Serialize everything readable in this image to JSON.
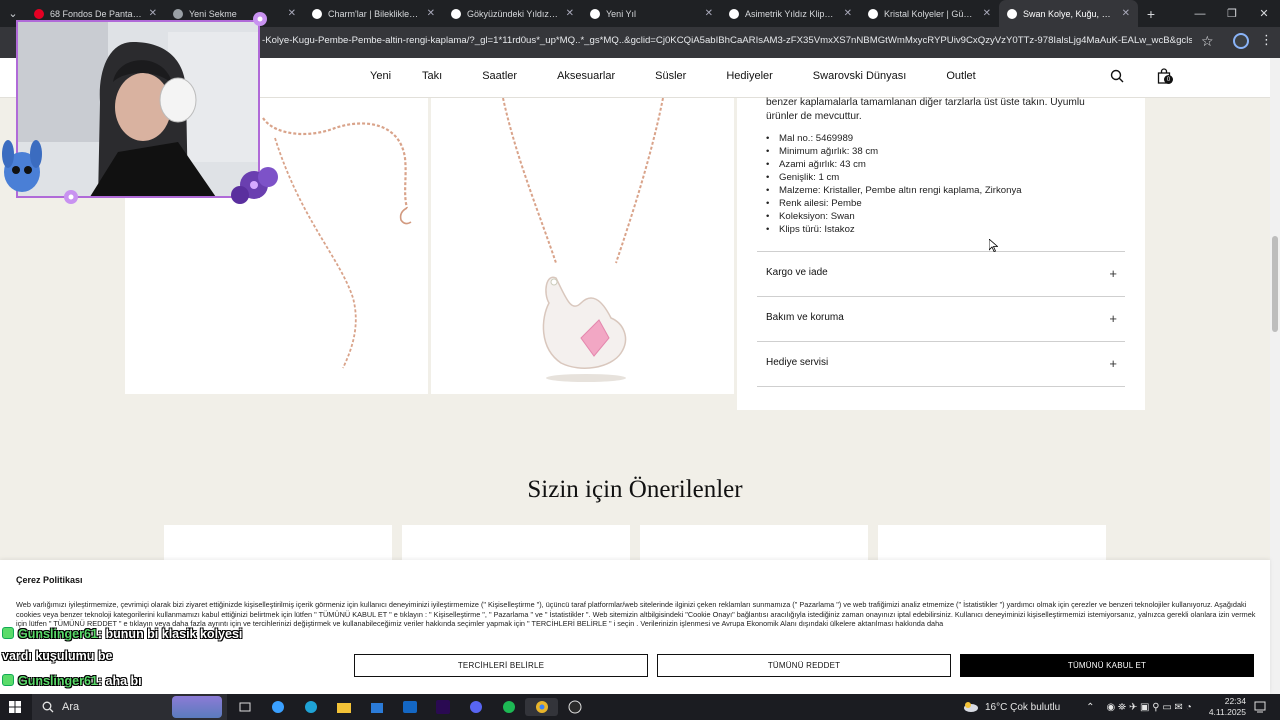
{
  "browser": {
    "tabs": [
      {
        "title": "68 Fondos De Pantalla De",
        "color": "#e60023",
        "active": false
      },
      {
        "title": "Yeni Sekme",
        "color": "#9aa0a6",
        "active": false
      },
      {
        "title": "Charm'lar | Bileklikler ve K",
        "color": "#ffffff",
        "active": false
      },
      {
        "title": "Gökyüzündeki Yıldız Bileziği",
        "color": "#ffffff",
        "active": false
      },
      {
        "title": "Yeni Yıl",
        "color": "#ffffff",
        "active": false
      },
      {
        "title": "Asimetrik Yıldız Klipsli Yıld",
        "color": "#ffffff",
        "active": false
      },
      {
        "title": "Kristal Kolyeler | Gümüş ve",
        "color": "#ffffff",
        "active": false
      },
      {
        "title": "Swan Kolye, Kuğu, Pembe",
        "color": "#ffffff",
        "active": true
      }
    ],
    "url": "-Kolye-Kugu-Pembe-Pembe-altin-rengi-kaplama/?_gl=1*11rd0us*_up*MQ..*_gs*MQ..&gclid=Cj0KCQiA5abIBhCaARIsAM3-zFX35VmxXS7nNBMGtWmMxycRYPUiv9CxQzyVzY0TTz-978IalsLjg4MaAuK-EALw_wcB&gclsrc=aw.ds&..."
  },
  "site": {
    "nav": [
      "Yeni",
      "Takı",
      "Saatler",
      "Aksesuarlar",
      "Süsler",
      "Hediyeler",
      "Swarovski Dünyası",
      "Outlet"
    ],
    "cart_count": "0"
  },
  "product": {
    "description": "benzer kaplamalarla tamamlanan diğer tarzlarla üst üste takın. Uyumlu ürünler de mevcuttur.",
    "specs": [
      "Mal no.: 5469989",
      "Minimum ağırlık: 38 cm",
      "Azami ağırlık: 43 cm",
      "Genişlik: 1 cm",
      "Malzeme:  Kristaller, Pembe altın rengi kaplama, Zirkonya",
      "Renk ailesi:  Pembe",
      "Koleksiyon:  Swan",
      "Klips türü:  Istakoz"
    ],
    "accordions": [
      "Kargo ve iade",
      "Bakım ve koruma",
      "Hediye servisi"
    ]
  },
  "recommendations": {
    "title": "Sizin için Önerilenler"
  },
  "cookie": {
    "title": "Çerez Politikası",
    "text": "Web varlığımızı iyileştirmemize, çevrimiçi olarak bizi ziyaret ettiğinizde kişiselleştirilmiş içerik görmeniz için kullanıcı deneyiminizi iyileştirmemize (\" Kişiselleştirme \"), üçüncü taraf platformlar/web sitelerinde ilginizi çeken reklamları sunmamıza (\" Pazarlama \") ve web trafiğimizi analiz etmemize (\" İstatistikler \") yardımcı olmak için çerezler ve benzeri teknolojiler kullanıyoruz. Aşağıdaki cookies veya benzer teknoloji kategorilerini kullanmamızı kabul ettiğinizi belirtmek için lütfen \" TÜMÜNÜ KABUL ET \" e tıklayın : \" Kişiselleştirme \", \" Pazarlama \" ve \" İstatistikler \". Web sitemizin altbilgisindeki \"Cookie Onayı\" bağlantısı aracılığıyla istediğiniz zaman onayınızı iptal edebilirsiniz. Kullanıcı deneyiminizi kişiselleştirmemizi istemiyorsanız, yalnızca gerekli olanlara izin vermek için lütfen \" TÜMÜNÜ REDDET \" e tıklayın veya daha fazla ayrıntı için ve tercihlerinizi değiştirmek ve kullanabileceğimiz veriler hakkında seçimler yapmak için \" TERCİHLERİ BELİRLE \" i seçin . Verilerinizin işlenmesi ve Avrupa Ekonomik Alanı dışındaki ülkelere aktarılması hakkında daha",
    "buttons": {
      "preferences": "TERCİHLERİ BELİRLE",
      "reject_all": "TÜMÜNÜ REDDET",
      "accept_all": "TÜMÜNÜ KABUL ET"
    }
  },
  "chat": [
    {
      "nick": "Gunslinger61",
      "message": ": bunun bi klasik kolyesi"
    },
    {
      "nick": "",
      "message": "vardı kuşulumu be"
    },
    {
      "nick": "Gunslinger61",
      "message": ": aha bı"
    }
  ],
  "taskbar": {
    "search_placeholder": "Ara",
    "weather": "16°C  Çok bulutlu",
    "time": "22:34",
    "date": "4.11.2025"
  }
}
